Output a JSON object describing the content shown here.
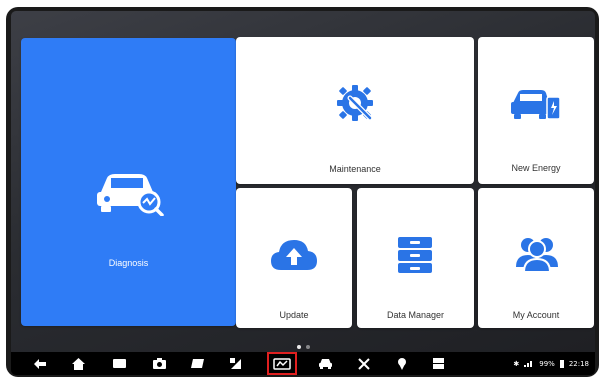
{
  "tiles": {
    "diagnosis": {
      "label": "Diagnosis",
      "icon": "car-diagnosis-icon"
    },
    "maintenance": {
      "label": "Maintenance",
      "icon": "wrench-gear-icon"
    },
    "new_energy": {
      "label": "New Energy",
      "icon": "car-charging-icon"
    },
    "update": {
      "label": "Update",
      "icon": "cloud-upload-icon"
    },
    "data_manager": {
      "label": "Data Manager",
      "icon": "file-drawer-icon"
    },
    "my_account": {
      "label": "My Account",
      "icon": "users-icon"
    }
  },
  "pagination": {
    "pages": 2,
    "current": 1
  },
  "navbar": {
    "buttons": [
      "back-icon",
      "home-icon",
      "recent-apps-icon",
      "camera-icon",
      "gallery-icon",
      "screenshot-icon",
      "vci-icon",
      "car-icon",
      "settings-tool-icon",
      "pin-icon",
      "grid-icon"
    ],
    "status_time": "22:18",
    "status_battery": "99%"
  },
  "colors": {
    "accent": "#2f7cf6",
    "highlight": "#e02020",
    "tile": "#ffffff"
  }
}
